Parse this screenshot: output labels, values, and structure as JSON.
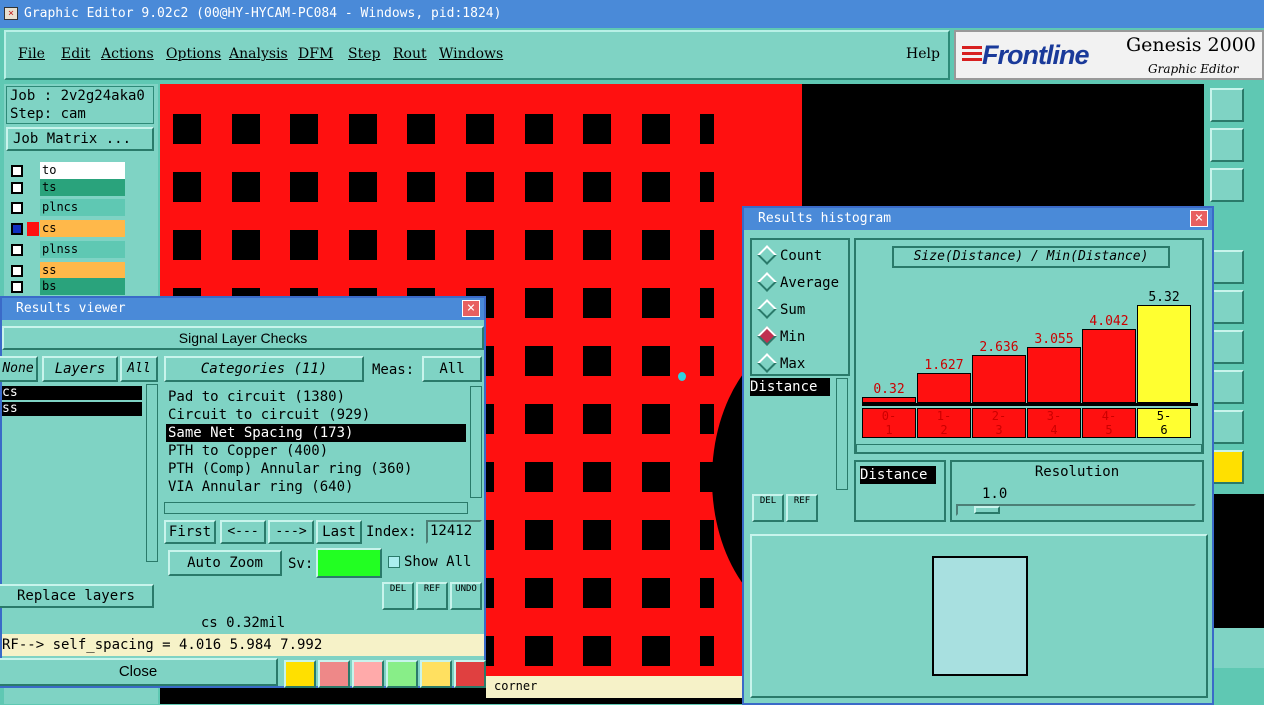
{
  "window": {
    "title": "Graphic Editor 9.02c2 (00@HY-HYCAM-PC084 - Windows, pid:1824)"
  },
  "menu": {
    "items": [
      "File",
      "Edit",
      "Actions",
      "Options",
      "Analysis",
      "DFM",
      "Step",
      "Rout",
      "Windows"
    ],
    "help": "Help"
  },
  "brand": {
    "logo": "Frontline",
    "product": "Genesis 2000",
    "subtitle": "Graphic Editor"
  },
  "job": {
    "job_line": "Job : 2v2g24aka0",
    "step_line": "Step: cam",
    "matrix_button": "Job Matrix ..."
  },
  "layers": [
    {
      "name": "to",
      "color": "#ffffff"
    },
    {
      "name": "ts",
      "color": "#2aa37c"
    },
    {
      "name": "plncs",
      "color": "#5fc8b3"
    },
    {
      "name": "cs",
      "color": "#ffb84a"
    },
    {
      "name": "plnss",
      "color": "#5fc8b3"
    },
    {
      "name": "ss",
      "color": "#ffb84a"
    },
    {
      "name": "bs",
      "color": "#2aa37c"
    }
  ],
  "results_viewer": {
    "title": "Results viewer",
    "header": "Signal Layer Checks",
    "none_btn": "None",
    "layers_btn": "Layers",
    "all_btn": "All",
    "layer_list": [
      "cs",
      "ss"
    ],
    "categories_btn": "Categories (11)",
    "meas_label": "Meas:",
    "meas_value": "All",
    "categories": [
      "Pad to circuit (1380)",
      "Circuit to circuit (929)",
      "Same Net Spacing (173)",
      "PTH to Copper (400)",
      "PTH (Comp) Annular ring (360)",
      "VIA Annular ring (640)"
    ],
    "first": "First",
    "prev": "<---",
    "next": "--->",
    "last": "Last",
    "index_label": "Index:",
    "index_value": "12412",
    "auto_zoom": "Auto Zoom",
    "sv_label": "Sv:",
    "show_all": "Show All",
    "replace_layers": "Replace layers",
    "del": "DEL",
    "ref": "REF",
    "undo": "UNDO",
    "layer_value": "cs 0.32mil",
    "info_line": "RF--> self_spacing = 4.016 5.984 7.992",
    "close": "Close"
  },
  "histogram": {
    "title": "Results histogram",
    "options": [
      "Count",
      "Average",
      "Sum",
      "Min",
      "Max"
    ],
    "selected": "Min",
    "field_label": "Distance",
    "chart_title": "Size(Distance) / Min(Distance)",
    "resolution_label": "Resolution",
    "resolution_value": "1.0",
    "del": "DEL",
    "ref": "REF"
  },
  "chart_data": {
    "type": "bar",
    "title": "Size(Distance) / Min(Distance)",
    "categories": [
      "0-\n1",
      "1-\n2",
      "2-\n3",
      "3-\n4",
      "4-\n5",
      "5-\n6"
    ],
    "values": [
      0.32,
      1.627,
      2.636,
      3.055,
      4.042,
      5.32
    ],
    "highlight_index": 5,
    "colors": {
      "bar": "#ff1010",
      "highlight": "#ffff30"
    },
    "ylim": [
      0,
      6
    ]
  },
  "status": {
    "text": "corner"
  },
  "colors": {
    "accent": "#4a8ad8",
    "panel": "#7fd3c4",
    "copper": "#ff1010"
  }
}
